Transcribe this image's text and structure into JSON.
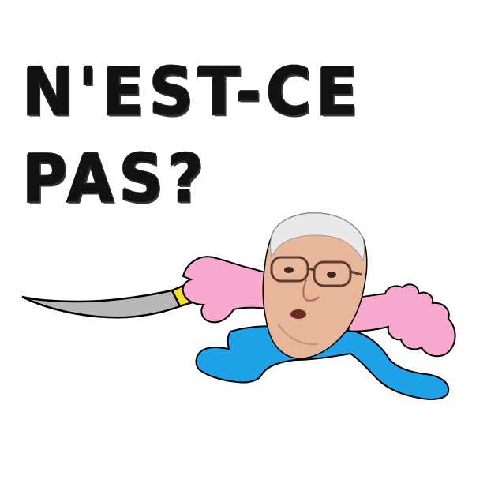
{
  "caption": {
    "line1": "N'EST-CE",
    "line2": "PAS?"
  },
  "colors": {
    "text": "#111111",
    "skin_pink": "#f9a8cf",
    "legs_blue": "#1fa2e8",
    "blade_grey": "#b7b7b7",
    "handle_yellow": "#f5e020",
    "outline": "#000000"
  },
  "figure": {
    "description_icon": "running-man-with-knife-drawing"
  }
}
